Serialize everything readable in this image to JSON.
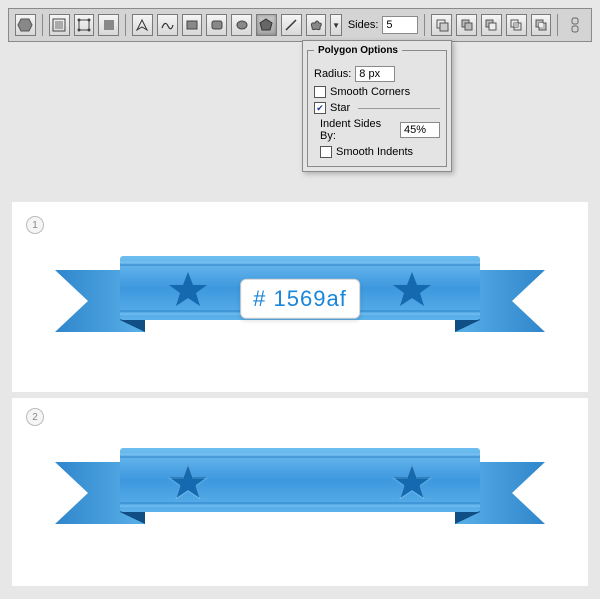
{
  "toolbar": {
    "sides_label": "Sides:",
    "sides_value": "5"
  },
  "popover": {
    "title": "Polygon Options",
    "radius_label": "Radius:",
    "radius_value": "8 px",
    "smooth_corners_label": "Smooth Corners",
    "smooth_corners_checked": false,
    "star_label": "Star",
    "star_checked": true,
    "indent_label": "Indent Sides By:",
    "indent_value": "45%",
    "smooth_indents_label": "Smooth Indents",
    "smooth_indents_checked": false
  },
  "panels": {
    "step1": "1",
    "step2": "2",
    "color_hex": "# 1569af"
  },
  "colors": {
    "ribbon_main": "#4aa7e8",
    "ribbon_dark": "#2a7fc4",
    "ribbon_shadow": "#1569af",
    "star": "#1569af"
  },
  "chart_data": null
}
